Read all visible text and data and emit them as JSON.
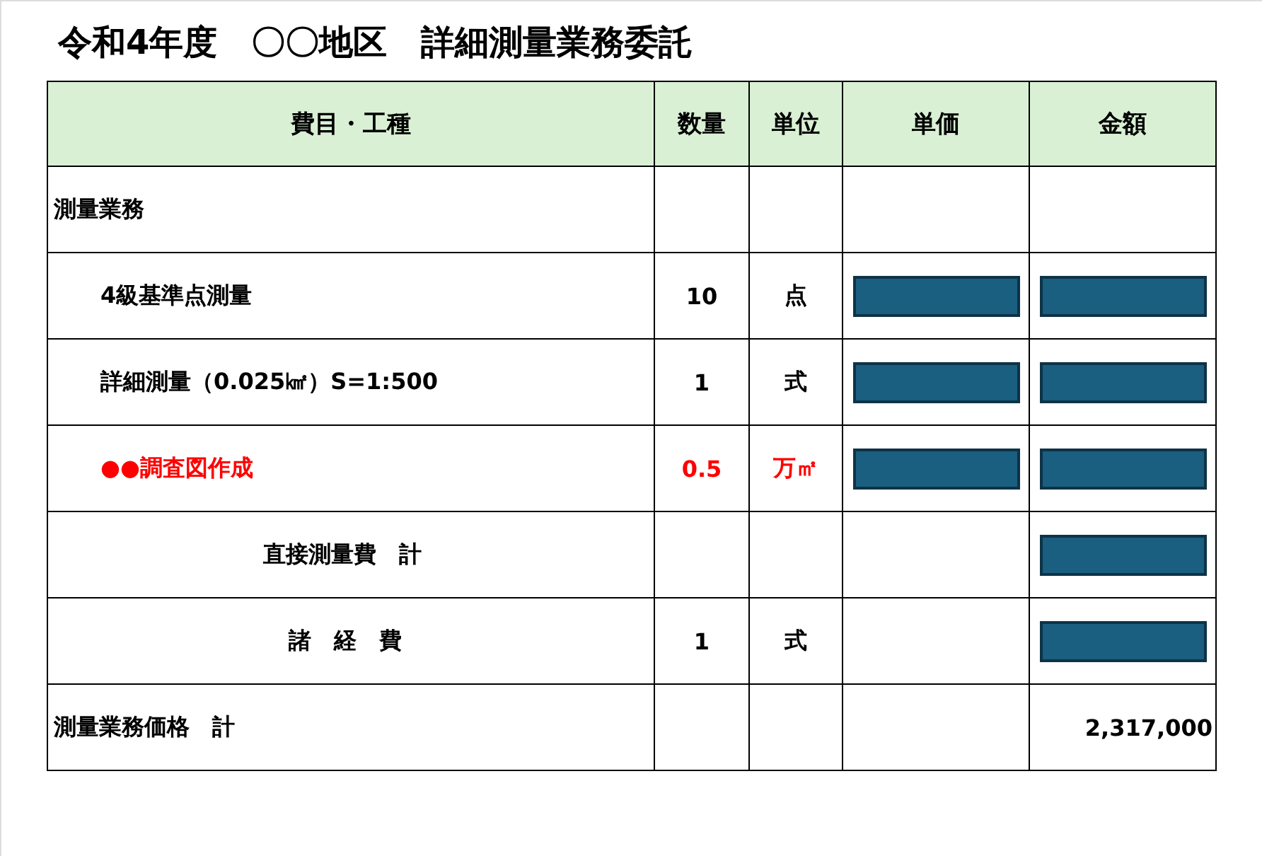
{
  "title": "令和4年度　〇〇地区　詳細測量業務委託",
  "columns": [
    "費目・工種",
    "数量",
    "単位",
    "単価",
    "金額"
  ],
  "rows": [
    {
      "kind": "heading",
      "item": "測量業務",
      "unit_price_redacted": false,
      "amount_redacted": false
    },
    {
      "kind": "item",
      "item": "4級基準点測量",
      "quantity": "10",
      "unit": "点",
      "unit_price_redacted": true,
      "amount_redacted": true
    },
    {
      "kind": "item",
      "item": "詳細測量（0.025㎢）S=1:500",
      "quantity": "1",
      "unit": "式",
      "unit_price_redacted": true,
      "amount_redacted": true
    },
    {
      "kind": "item",
      "item": "●●調査図作成",
      "quantity": "0.5",
      "unit": "万㎡",
      "color": "#ff0000",
      "unit_price_redacted": true,
      "amount_redacted": true
    },
    {
      "kind": "subtotal",
      "item": "直接測量費　計",
      "unit_price_redacted": false,
      "amount_redacted": true
    },
    {
      "kind": "expense",
      "item": "諸　経　費",
      "quantity": "1",
      "unit": "式",
      "unit_price_redacted": false,
      "amount_redacted": true
    },
    {
      "kind": "total",
      "item": "測量業務価格　計",
      "unit_price_redacted": false,
      "amount_redacted": false,
      "amount": "2,317,000"
    }
  ]
}
